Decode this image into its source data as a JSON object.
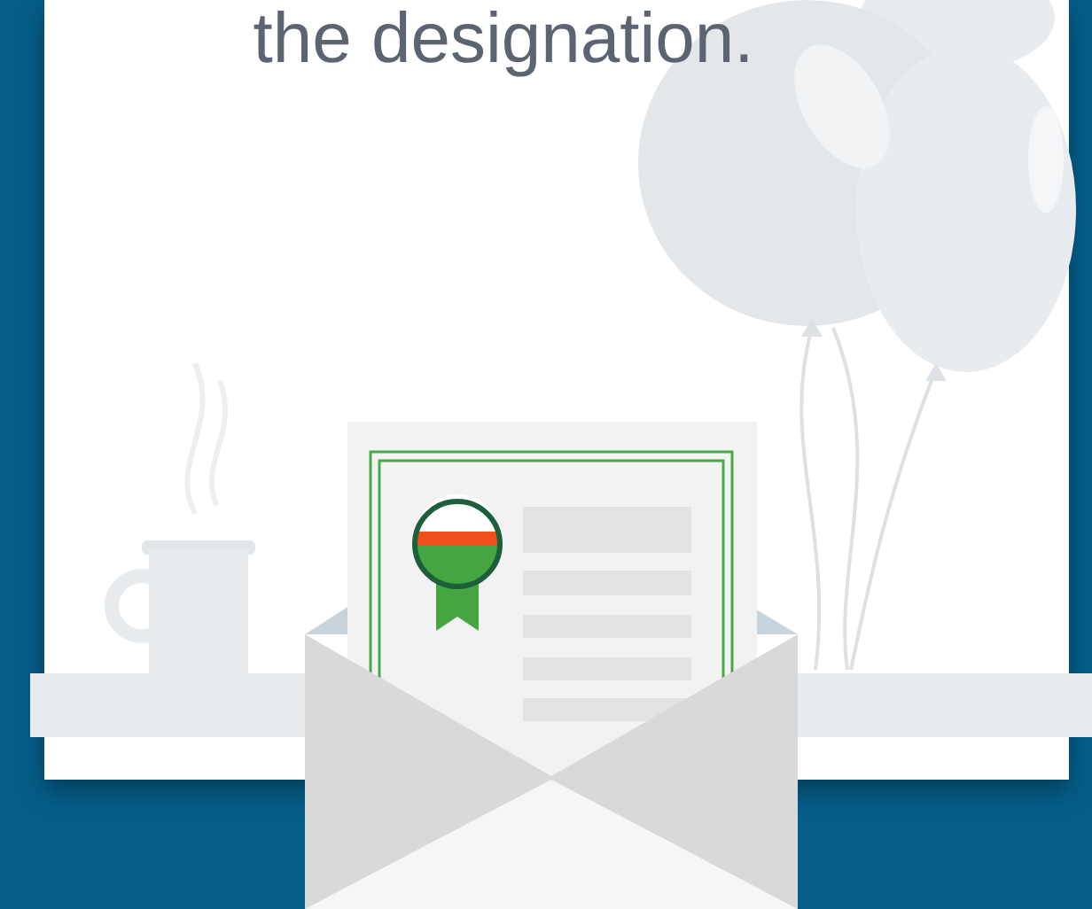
{
  "heading": "the designation."
}
